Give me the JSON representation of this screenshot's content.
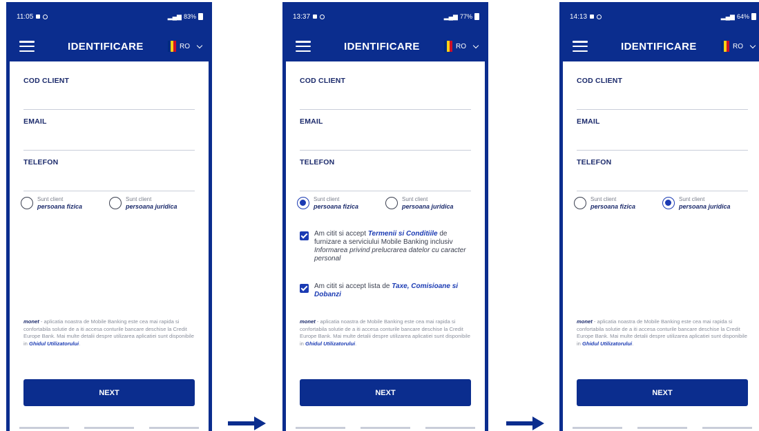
{
  "common": {
    "title": "IDENTIFICARE",
    "lang": "RO",
    "fields": {
      "cod_client": "COD CLIENT",
      "email": "EMAIL",
      "telefon": "TELEFON"
    },
    "radio_top": "Sunt client",
    "radio_fizica": "persoana fizica",
    "radio_juridica": "persoana juridica",
    "check1": {
      "prefix": "Am citit si accept ",
      "link": "Termenii si Conditiile",
      "middle": " de furnizare a serviciului Mobile Banking inclusiv ",
      "italic": "Informarea privind prelucrarea datelor cu caracter personal"
    },
    "check2": {
      "prefix": "Am citit si accept lista de ",
      "link": "Taxe, Comisioane si Dobanzi"
    },
    "info": {
      "brand": "monet",
      "text": " - aplicatia noastra de Mobile Banking este cea mai rapida si confortabila solutie de a iti accesa conturile bancare deschise la Credit Europe Bank. Mai multe detalii despre utilizarea aplicatiei sunt disponibile in ",
      "link": "Ghidul Utilizatorului",
      "end": "."
    },
    "next": "NEXT"
  },
  "screens": [
    {
      "time": "11:05",
      "battery": "83%",
      "selected": "none",
      "terms_visible": false
    },
    {
      "time": "13:37",
      "battery": "77%",
      "selected": "fizica",
      "terms_visible": true
    },
    {
      "time": "14:13",
      "battery": "64%",
      "selected": "juridica",
      "terms_visible": false
    }
  ],
  "colors": {
    "brand_blue": "#0b2d8e",
    "accent_blue": "#1b3bb3",
    "flag": [
      "#002b7f",
      "#fcd116",
      "#ce1126"
    ]
  }
}
